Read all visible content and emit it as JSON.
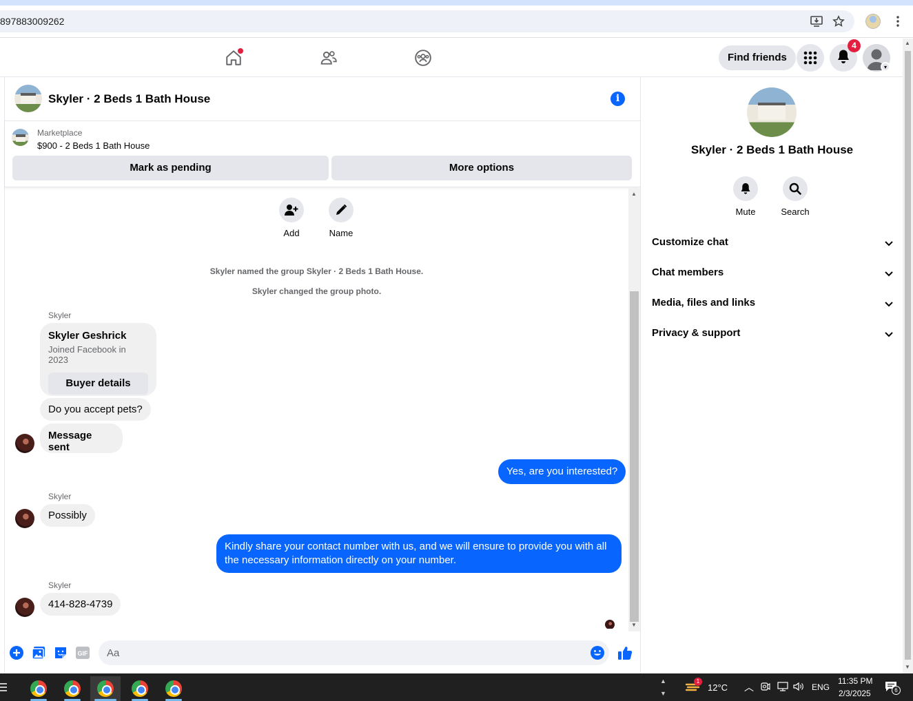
{
  "browser": {
    "url": "897883009262"
  },
  "nav": {
    "find_friends": "Find friends",
    "notifications_count": "4"
  },
  "chat": {
    "title": "Skyler · 2 Beds 1 Bath House",
    "marketplace_label": "Marketplace",
    "listing": "$900 - 2 Beds 1 Bath House",
    "mark_pending": "Mark as pending",
    "more_options": "More options",
    "actions": [
      {
        "label": "Add"
      },
      {
        "label": "Name"
      }
    ],
    "system_messages": [
      "Skyler named the group Skyler · 2 Beds 1 Bath House.",
      "Skyler changed the group photo."
    ],
    "buyer_card": {
      "sender": "Skyler",
      "name": "Skyler Geshrick",
      "joined": "Joined Facebook in 2023",
      "button": "Buyer details"
    },
    "messages": [
      {
        "from": "Skyler",
        "text": "Do you accept pets?"
      },
      {
        "from": "Skyler",
        "text": "Message sent"
      },
      {
        "from": "me",
        "text": "Yes, are you interested?"
      },
      {
        "from": "Skyler",
        "sender_label": "Skyler",
        "text": "Possibly"
      },
      {
        "from": "me",
        "text": "Kindly share your contact number with us, and we will ensure to provide you with all the necessary information directly on your number."
      },
      {
        "from": "Skyler",
        "sender_label": "Skyler",
        "text": "414-828-4739"
      }
    ],
    "composer_placeholder": "Aa"
  },
  "info_panel": {
    "title": "Skyler · 2 Beds 1 Bath House",
    "actions": [
      {
        "label": "Mute",
        "icon": "bell-icon"
      },
      {
        "label": "Search",
        "icon": "search-icon"
      }
    ],
    "sections": [
      "Customize chat",
      "Chat members",
      "Media, files and links",
      "Privacy & support"
    ]
  },
  "taskbar": {
    "weather_badge": "1",
    "temperature": "12°C",
    "language": "ENG",
    "time": "11:35 PM",
    "date": "2/3/2025",
    "notification_count": "6"
  },
  "colors": {
    "accent": "#0866ff",
    "badge": "#e41e3f",
    "bubble_in": "#f0f0f0",
    "taskbar": "#202020"
  }
}
